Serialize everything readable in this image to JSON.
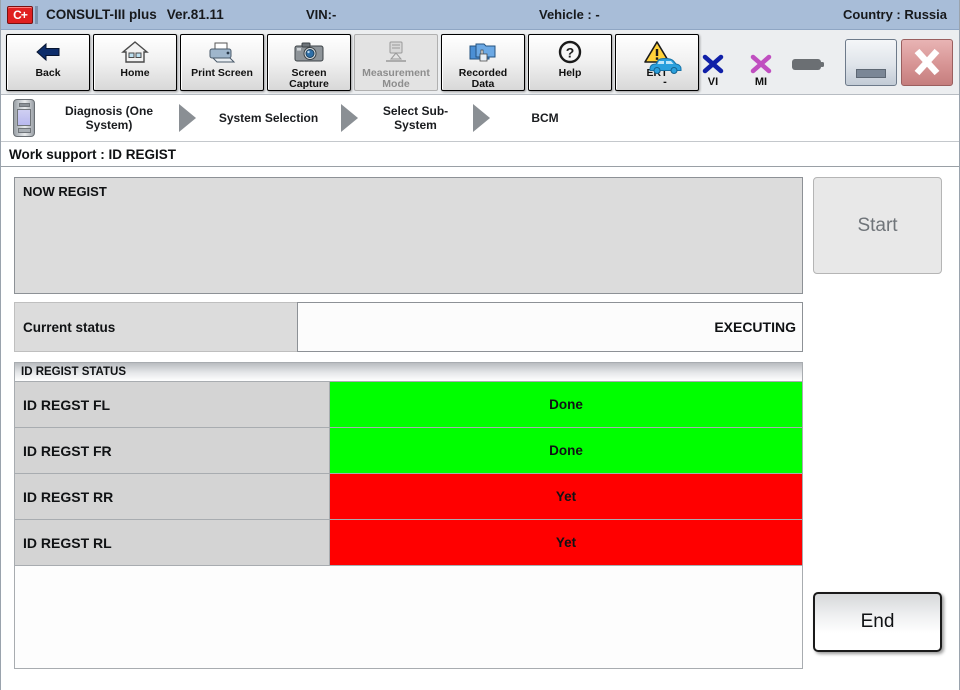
{
  "titlebar": {
    "logo": "consult-logo",
    "app_name": "CONSULT-III plus",
    "version": "Ver.81.11",
    "vin": "VIN:-",
    "vehicle": "Vehicle : -",
    "country": "Country : Russia"
  },
  "toolbar": {
    "buttons": [
      {
        "label": "Back",
        "icon": "back-arrow-icon",
        "enabled": true
      },
      {
        "label": "Home",
        "icon": "home-icon",
        "enabled": true
      },
      {
        "label": "Print Screen",
        "icon": "printer-icon",
        "enabled": true
      },
      {
        "label": "Screen\nCapture",
        "line1": "Screen",
        "line2": "Capture",
        "icon": "camera-icon",
        "enabled": true
      },
      {
        "label": "Measurement\nMode",
        "line1": "Measurement",
        "line2": "Mode",
        "icon": "measurement-icon",
        "enabled": false
      },
      {
        "label": "Recorded\nData",
        "line1": "Recorded",
        "line2": "Data",
        "icon": "folders-icon",
        "enabled": true
      },
      {
        "label": "Help",
        "icon": "help-question-icon",
        "enabled": true
      },
      {
        "label": "ERT",
        "icon": "warning-triangle-icon",
        "enabled": true
      }
    ],
    "status": {
      "vehicle_icon": "car-icon",
      "vehicle_label": "-",
      "vi_icon": "blue-x-icon",
      "vi_label": "VI",
      "mi_icon": "purple-x-icon",
      "mi_label": "MI",
      "battery_icon": "battery-icon",
      "battery_label": ""
    },
    "window": {
      "minimize": "minimize-button",
      "close": "close-button"
    }
  },
  "breadcrumb": {
    "device_icon": "vi-device-icon",
    "steps": [
      {
        "line1": "Diagnosis (One",
        "line2": "System)"
      },
      {
        "line1": "System Selection",
        "line2": ""
      },
      {
        "line1": "Select Sub-",
        "line2": "System"
      },
      {
        "line1": "BCM",
        "line2": ""
      }
    ]
  },
  "page": {
    "work_support_title": "Work support : ID REGIST"
  },
  "main": {
    "message": "NOW REGIST",
    "start_button": "Start",
    "end_button": "End",
    "status_label": "Current status",
    "status_value": "EXECUTING",
    "table": {
      "header": "ID REGIST STATUS",
      "rows": [
        {
          "label": "ID REGST FL",
          "value": "Done",
          "state": "done"
        },
        {
          "label": "ID REGST FR",
          "value": "Done",
          "state": "done"
        },
        {
          "label": "ID REGST RR",
          "value": "Yet",
          "state": "yet"
        },
        {
          "label": "ID REGST RL",
          "value": "Yet",
          "state": "yet"
        }
      ]
    }
  },
  "colors": {
    "titlebar_bg": "#a8bdd8",
    "done_green": "#00ff00",
    "yet_red": "#ff0000",
    "panel_grey": "#dcdcdc",
    "row_label_grey": "#d4d4d4",
    "accent_red": "#e02020"
  }
}
